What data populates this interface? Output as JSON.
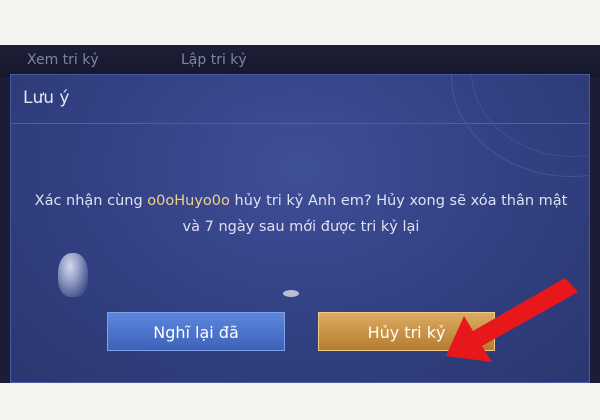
{
  "tabs": [
    {
      "label": "Xem tri kỷ",
      "active": true
    },
    {
      "label": "Lập tri kỷ",
      "active": false
    }
  ],
  "dialog": {
    "title": "Lưu ý",
    "message_part1": "Xác nhận cùng ",
    "player_name": "o0oHuyo0o",
    "message_part2": " hủy tri kỷ Anh em? Hủy xong sẽ xóa thân mật và 7 ngày sau mới được tri kỷ lại",
    "reconsider_button": "Nghĩ lại đã",
    "cancel_bond_button": "Hủy tri kỷ"
  },
  "colors": {
    "dialog_background": "#344286",
    "highlight_name": "#f2d089",
    "reconsider_button": "#4a72c9",
    "cancel_bond_button": "#c99245",
    "annotation_arrow": "#e8171c"
  },
  "annotation": {
    "icon": "red-arrow-icon",
    "points_to": "cancel_bond_button"
  }
}
